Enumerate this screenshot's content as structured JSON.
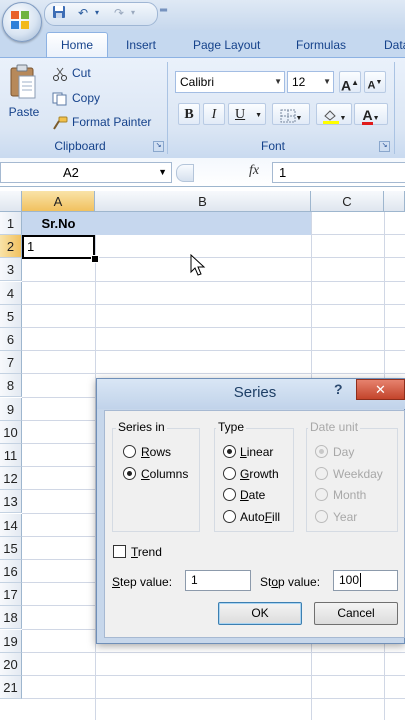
{
  "quick_access": {
    "save_icon": "save-icon",
    "undo_icon": "undo-icon",
    "redo_icon": "redo-icon",
    "customize_icon": "customize-qat-icon"
  },
  "tabs": [
    "Home",
    "Insert",
    "Page Layout",
    "Formulas",
    "Data"
  ],
  "clipboard": {
    "group_label": "Clipboard",
    "paste": "Paste",
    "cut": "Cut",
    "copy": "Copy",
    "format_painter": "Format Painter"
  },
  "font": {
    "group_label": "Font",
    "family": "Calibri",
    "size": "12",
    "grow": "A",
    "shrink": "A",
    "bold": "B",
    "italic": "I",
    "underline": "U",
    "font_color": "A"
  },
  "formula_bar": {
    "name_box": "A2",
    "fx": "fx",
    "value": "1"
  },
  "grid": {
    "columns": [
      "A",
      "B",
      "C"
    ],
    "rows": [
      "1",
      "2",
      "3",
      "4",
      "5",
      "6",
      "7",
      "8",
      "9",
      "10",
      "11",
      "12",
      "13",
      "14",
      "15",
      "16",
      "17",
      "18",
      "19",
      "20",
      "21"
    ],
    "a1": "Sr.No",
    "a2": "1"
  },
  "dialog": {
    "title": "Series",
    "help": "?",
    "close": "✕",
    "series_in": {
      "legend": "Series in",
      "options": [
        {
          "label": "Rows",
          "selected": false
        },
        {
          "label": "Columns",
          "selected": true
        }
      ]
    },
    "type": {
      "legend": "Type",
      "options": [
        {
          "label": "Linear",
          "selected": true
        },
        {
          "label": "Growth",
          "selected": false
        },
        {
          "label": "Date",
          "selected": false
        },
        {
          "label": "AutoFill",
          "selected": false
        }
      ]
    },
    "date_unit": {
      "legend": "Date unit",
      "options": [
        {
          "label": "Day",
          "selected": true
        },
        {
          "label": "Weekday",
          "selected": false
        },
        {
          "label": "Month",
          "selected": false
        },
        {
          "label": "Year",
          "selected": false
        }
      ]
    },
    "trend": "Trend",
    "step_label": "Step value:",
    "step_value": "1",
    "stop_label": "Stop value:",
    "stop_value": "100",
    "ok": "OK",
    "cancel": "Cancel"
  }
}
